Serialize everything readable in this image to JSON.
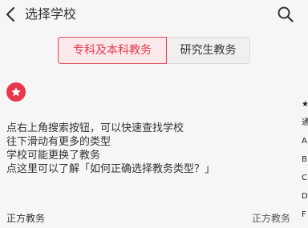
{
  "header": {
    "title": "选择学校"
  },
  "segments": {
    "primary": "专科及本科教务",
    "secondary": "研究生教务"
  },
  "tips": {
    "line1": "点右上角搜索按钮，可以快速查找学校",
    "line2": "往下滑动有更多的类型",
    "line3": "学校可能更换了教务",
    "line4": "点这里可以了解「如何正确选择教务类型？」"
  },
  "list": {
    "first_item_left": "正方教务",
    "first_item_right": "正方教务"
  },
  "index_bar": [
    "★",
    "通",
    "A",
    "B",
    "C",
    "D",
    "F"
  ],
  "colors": {
    "accent": "#e8374a",
    "background": "#f6f6f6"
  },
  "icons": {
    "back": "chevron-left-icon",
    "search": "search-icon",
    "badge": "star-icon"
  }
}
